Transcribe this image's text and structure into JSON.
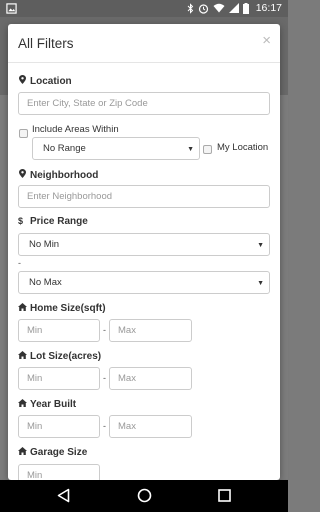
{
  "status_bar": {
    "time": "16:17",
    "icons": [
      "image-icon",
      "bluetooth-icon",
      "alarm-icon",
      "wifi-icon",
      "signal-icon",
      "battery-icon"
    ]
  },
  "modal": {
    "title": "All Filters",
    "close_glyph": "×",
    "location": {
      "label": "Location",
      "placeholder": "Enter City, State or Zip Code"
    },
    "include_areas": {
      "label": "Include Areas Within",
      "range_value": "No Range",
      "my_location_label": "My Location"
    },
    "neighborhood": {
      "label": "Neighborhood",
      "placeholder": "Enter Neighborhood"
    },
    "price_range": {
      "label": "Price Range",
      "min_value": "No Min",
      "separator": "-",
      "max_value": "No Max"
    },
    "home_size": {
      "label": "Home Size(sqft)",
      "min_placeholder": "Min",
      "max_placeholder": "Max",
      "separator": "-"
    },
    "lot_size": {
      "label": "Lot Size(acres)",
      "min_placeholder": "Min",
      "max_placeholder": "Max",
      "separator": "-"
    },
    "year_built": {
      "label": "Year Built",
      "min_placeholder": "Min",
      "max_placeholder": "Max",
      "separator": "-"
    },
    "garage_size": {
      "label": "Garage Size",
      "min_placeholder": "Min"
    }
  },
  "icons": {
    "marker": "map-marker-icon",
    "dollar": "$",
    "home": "home-icon"
  },
  "colors": {
    "status_bar": "#5e5e5e",
    "backdrop": "#7d7d7d",
    "nav_bar": "#000000",
    "input_border": "#cccccc",
    "placeholder": "#999999"
  }
}
